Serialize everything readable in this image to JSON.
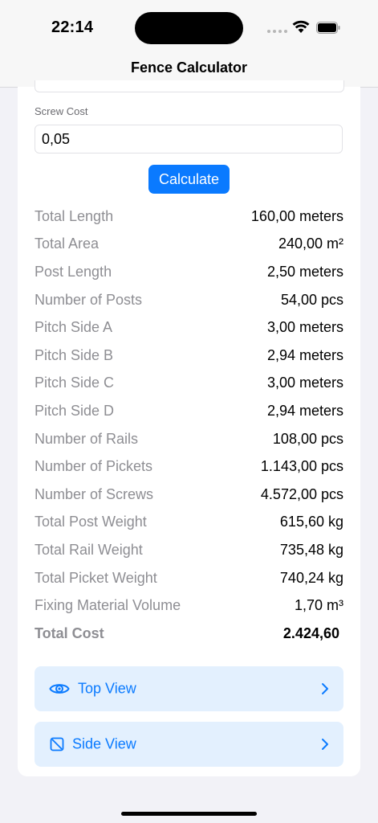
{
  "status_bar": {
    "time": "22:14"
  },
  "nav": {
    "title": "Fence Calculator"
  },
  "form": {
    "screw_cost_label": "Screw Cost",
    "screw_cost_value": "0,05",
    "calculate_label": "Calculate"
  },
  "results": [
    {
      "label": "Total Length",
      "value": "160,00 meters"
    },
    {
      "label": "Total Area",
      "value": "240,00 m²"
    },
    {
      "label": "Post Length",
      "value": "2,50 meters"
    },
    {
      "label": "Number of Posts",
      "value": "54,00 pcs"
    },
    {
      "label": "Pitch Side A",
      "value": "3,00 meters"
    },
    {
      "label": "Pitch Side B",
      "value": "2,94 meters"
    },
    {
      "label": "Pitch Side C",
      "value": "3,00 meters"
    },
    {
      "label": "Pitch Side D",
      "value": "2,94 meters"
    },
    {
      "label": "Number of Rails",
      "value": "108,00 pcs"
    },
    {
      "label": "Number of Pickets",
      "value": "1.143,00 pcs"
    },
    {
      "label": "Number of Screws",
      "value": "4.572,00 pcs"
    },
    {
      "label": "Total Post Weight",
      "value": "615,60 kg"
    },
    {
      "label": "Total Rail Weight",
      "value": "735,48 kg"
    },
    {
      "label": "Total Picket Weight",
      "value": "740,24 kg"
    },
    {
      "label": "Fixing Material Volume",
      "value": "1,70 m³"
    },
    {
      "label": "Total Cost",
      "value": "2.424,60"
    }
  ],
  "links": {
    "top_view": {
      "label": "Top View",
      "icon": "eye-icon"
    },
    "side_view": {
      "label": "Side View",
      "icon": "square-slash-icon"
    }
  },
  "colors": {
    "accent": "#0a7aff",
    "link_background": "#e3f0fe",
    "page_background": "#f2f2f7"
  }
}
